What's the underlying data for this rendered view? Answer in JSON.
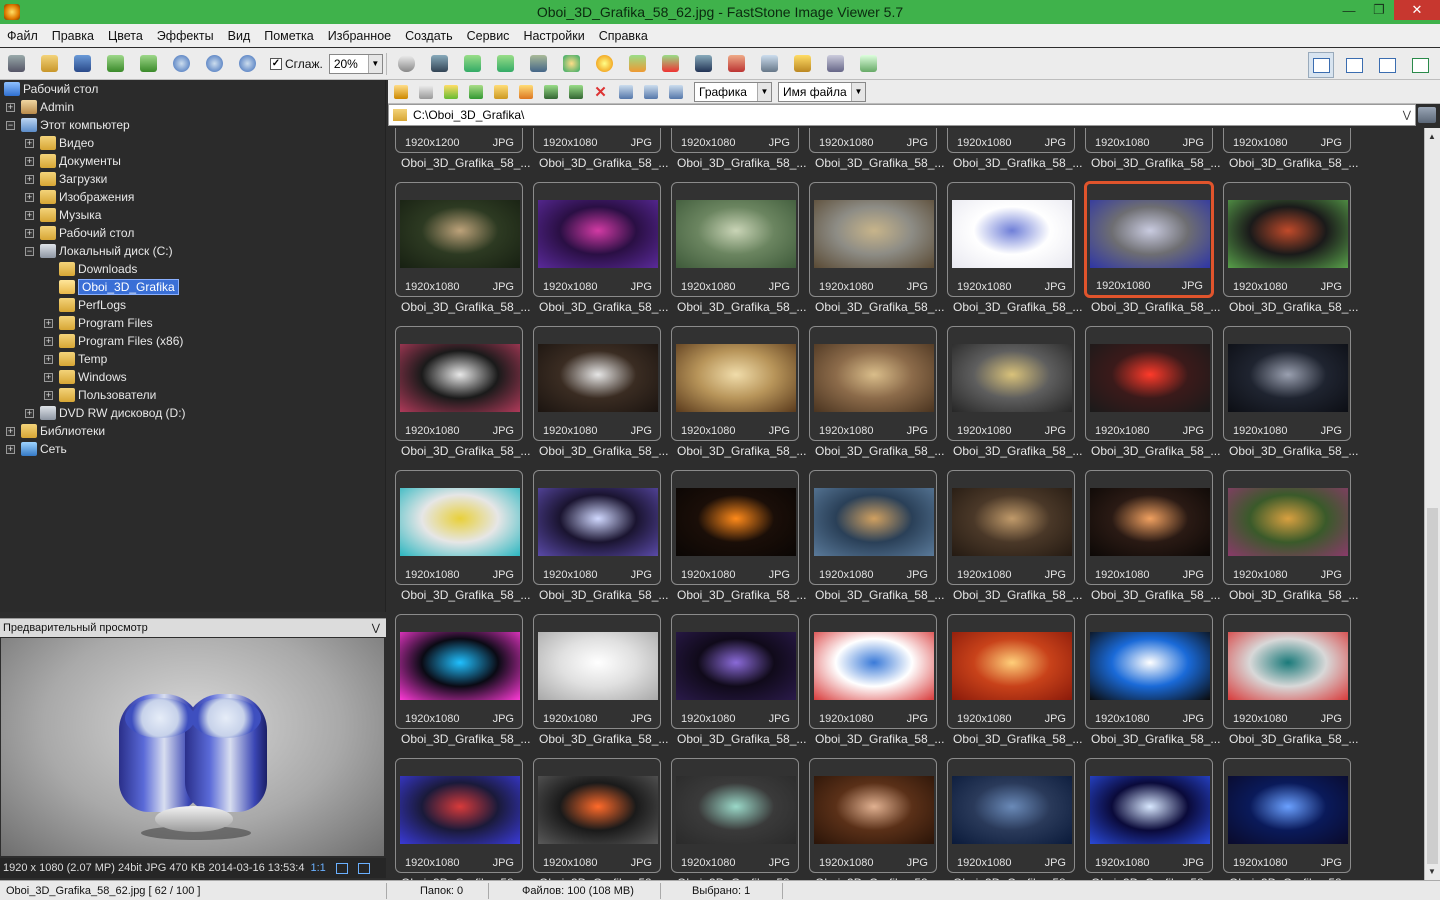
{
  "window": {
    "title": "Oboi_3D_Grafika_58_62.jpg  -  FastStone Image Viewer 5.7"
  },
  "menu": [
    "Файл",
    "Правка",
    "Цвета",
    "Эффекты",
    "Вид",
    "Пометка",
    "Избранное",
    "Создать",
    "Сервис",
    "Настройки",
    "Справка"
  ],
  "toolbar": {
    "smooth_label": "Сглаж.",
    "smooth_checked": true,
    "zoom": "20%"
  },
  "nav": {
    "filter": "Графика",
    "sort": "Имя файла"
  },
  "path": "C:\\Oboi_3D_Grafika\\",
  "tree": [
    {
      "label": "Рабочий стол",
      "icon": "desktop-icon"
    },
    {
      "label": "Admin",
      "icon": "user-folder-icon"
    },
    {
      "label": "Этот компьютер",
      "icon": "computer-icon"
    },
    {
      "label": "Видео",
      "icon": "folder-icon"
    },
    {
      "label": "Документы",
      "icon": "folder-icon"
    },
    {
      "label": "Загрузки",
      "icon": "folder-icon"
    },
    {
      "label": "Изображения",
      "icon": "folder-icon"
    },
    {
      "label": "Музыка",
      "icon": "folder-icon"
    },
    {
      "label": "Рабочий стол",
      "icon": "folder-icon"
    },
    {
      "label": "Локальный диск (C:)",
      "icon": "drive-icon"
    },
    {
      "label": "Downloads",
      "icon": "folder-icon"
    },
    {
      "label": "Oboi_3D_Grafika",
      "icon": "folder-icon"
    },
    {
      "label": "PerfLogs",
      "icon": "folder-icon"
    },
    {
      "label": "Program Files",
      "icon": "folder-icon"
    },
    {
      "label": "Program Files (x86)",
      "icon": "folder-icon"
    },
    {
      "label": "Temp",
      "icon": "folder-icon"
    },
    {
      "label": "Windows",
      "icon": "folder-icon"
    },
    {
      "label": "Пользователи",
      "icon": "folder-icon"
    },
    {
      "label": "DVD RW дисковод (D:)",
      "icon": "dvd-icon"
    },
    {
      "label": "Библиотеки",
      "icon": "folder-icon"
    },
    {
      "label": "Сеть",
      "icon": "network-icon"
    }
  ],
  "preview": {
    "label": "Предварительный просмотр",
    "info": "1920 x 1080 (2.07 MP)  24bit  JPG   470 KB   2014-03-16 13:53:4",
    "ratio": "1:1"
  },
  "thumb_meta": {
    "res_1200": "1920x1200",
    "res": "1920x1080",
    "fmt": "JPG",
    "caption": "Oboi_3D_Grafika_58_..."
  },
  "thumbs": [
    {
      "res": "1920x1200",
      "c1": "#7fae2f",
      "c2": "#c8e04a",
      "c3": "#3b5e17"
    },
    {
      "res": "1920x1080",
      "c1": "#111111",
      "c2": "#2b2b2b",
      "c3": "#090909"
    },
    {
      "res": "1920x1080",
      "c1": "#2a0535",
      "c2": "#c238d8",
      "c3": "#150418"
    },
    {
      "res": "1920x1080",
      "c1": "#f2b6d8",
      "c2": "#fde6f3",
      "c3": "#e18ac0"
    },
    {
      "res": "1920x1080",
      "c1": "#f3f3f3",
      "c2": "#b98a2c",
      "c3": "#ffffff"
    },
    {
      "res": "1920x1080",
      "c1": "#5a3e2b",
      "c2": "#8c6b4e",
      "c3": "#2a1c12"
    },
    {
      "res": "1920x1080",
      "c1": "#6b4a31",
      "c2": "#c99a6a",
      "c3": "#3b281b"
    },
    {
      "res": "1920x1080",
      "c1": "#2d3a22",
      "c2": "#bda27a",
      "c3": "#172012"
    },
    {
      "res": "1920x1080",
      "c1": "#2a0f44",
      "c2": "#d23aa4",
      "c3": "#5a2a9a"
    },
    {
      "res": "1920x1080",
      "c1": "#6b8560",
      "c2": "#c9d4b6",
      "c3": "#3e5a3a"
    },
    {
      "res": "1920x1080",
      "c1": "#8d8c85",
      "c2": "#c7b48a",
      "c3": "#5a4a34"
    },
    {
      "res": "1920x1080",
      "c1": "#ffffff",
      "c2": "#6f7fd8",
      "c3": "#e8e8f0"
    },
    {
      "res": "1920x1080",
      "c1": "#6e6e72",
      "c2": "#c9cbe0",
      "c3": "#2e35a6",
      "sel": true
    },
    {
      "res": "1920x1080",
      "c1": "#1a1a1a",
      "c2": "#c04a2a",
      "c3": "#58a04a"
    },
    {
      "res": "1920x1080",
      "c1": "#1a1a1a",
      "c2": "#e8e8e8",
      "c3": "#b03a5a"
    },
    {
      "res": "1920x1080",
      "c1": "#3a2c22",
      "c2": "#e6e6e6",
      "c3": "#1b1410"
    },
    {
      "res": "1920x1080",
      "c1": "#b8955a",
      "c2": "#f0dcaa",
      "c3": "#5a3a1c"
    },
    {
      "res": "1920x1080",
      "c1": "#8c6b4a",
      "c2": "#d9bd8a",
      "c3": "#4a3420"
    },
    {
      "res": "1920x1080",
      "c1": "#5e5e5e",
      "c2": "#d9c27a",
      "c3": "#262626"
    },
    {
      "res": "1920x1080",
      "c1": "#3b1a1a",
      "c2": "#ff3a2a",
      "c3": "#1a1a1a"
    },
    {
      "res": "1920x1080",
      "c1": "#1f2430",
      "c2": "#9aa0b0",
      "c3": "#0c0e14"
    },
    {
      "res": "1920x1080",
      "c1": "#e6e6e6",
      "c2": "#e8d03a",
      "c3": "#2ab6c0"
    },
    {
      "res": "1920x1080",
      "c1": "#1a1430",
      "c2": "#d0d8ff",
      "c3": "#5a4aa8"
    },
    {
      "res": "1920x1080",
      "c1": "#1a0e08",
      "c2": "#ff8a1a",
      "c3": "#0a0604"
    },
    {
      "res": "1920x1080",
      "c1": "#2a4058",
      "c2": "#d0a060",
      "c3": "#5a7a9a"
    },
    {
      "res": "1920x1080",
      "c1": "#4a3828",
      "c2": "#c09a6a",
      "c3": "#241a12"
    },
    {
      "res": "1920x1080",
      "c1": "#2a1a14",
      "c2": "#f0a060",
      "c3": "#0c0806"
    },
    {
      "res": "1920x1080",
      "c1": "#3a5a2a",
      "c2": "#d8a040",
      "c3": "#8a3a6a"
    },
    {
      "res": "1920x1080",
      "c1": "#0a0a14",
      "c2": "#20c0ff",
      "c3": "#ff3ad8"
    },
    {
      "res": "1920x1080",
      "c1": "#e0e0e0",
      "c2": "#ffffff",
      "c3": "#a8a8a8"
    },
    {
      "res": "1920x1080",
      "c1": "#100a1a",
      "c2": "#8a6ad8",
      "c3": "#2a1a4a"
    },
    {
      "res": "1920x1080",
      "c1": "#ffffff",
      "c2": "#3a7ad8",
      "c3": "#d83a3a"
    },
    {
      "res": "1920x1080",
      "c1": "#c8421a",
      "c2": "#ffcf7a",
      "c3": "#8a1a0a"
    },
    {
      "res": "1920x1080",
      "c1": "#1a6ad8",
      "c2": "#ffffff",
      "c3": "#0a0a0a"
    },
    {
      "res": "1920x1080",
      "c1": "#d8d8d8",
      "c2": "#1a7a7a",
      "c3": "#d83a3a"
    },
    {
      "res": "1920x1080",
      "c1": "#1a1a3a",
      "c2": "#d83a3a",
      "c3": "#3a3ad8"
    },
    {
      "res": "1920x1080",
      "c1": "#1a1a1a",
      "c2": "#ff6a2a",
      "c3": "#5a5a5a"
    },
    {
      "res": "1920x1080",
      "c1": "#3a3a3a",
      "c2": "#9ad8c8",
      "c3": "#2a2a2a"
    },
    {
      "res": "1920x1080",
      "c1": "#5a3018",
      "c2": "#e0b090",
      "c3": "#2a1408"
    },
    {
      "res": "1920x1080",
      "c1": "#2a3a5a",
      "c2": "#6a8ab8",
      "c3": "#0a1a3a"
    },
    {
      "res": "1920x1080",
      "c1": "#0a0a3a",
      "c2": "#d8e8ff",
      "c3": "#2a4ad8"
    },
    {
      "res": "1920x1080",
      "c1": "#0a1a5a",
      "c2": "#6aa0ff",
      "c3": "#0a0a2a"
    }
  ],
  "status": {
    "file": "Oboi_3D_Grafika_58_62.jpg [ 62 / 100 ]",
    "folders": "Папок: 0",
    "files": "Файлов: 100 (108 MB)",
    "selected": "Выбрано: 1"
  }
}
